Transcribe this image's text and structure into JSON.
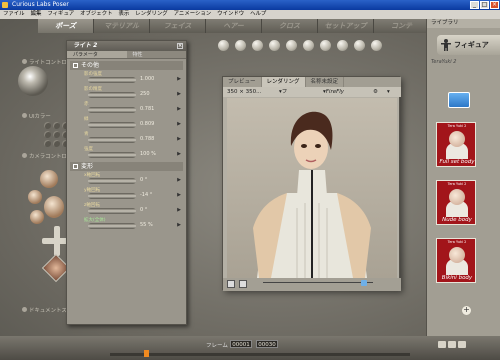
{
  "window": {
    "title": "Curious Labs Poser"
  },
  "menu": [
    "ファイル",
    "編集",
    "フィギュア",
    "オブジェクト",
    "表示",
    "レンダリング",
    "アニメーション",
    "ウインドウ",
    "ヘルプ"
  ],
  "rooms": [
    "ポーズ",
    "マテリアル",
    "フェイス",
    "ヘアー",
    "クロス",
    "セットアップ",
    "コンテ"
  ],
  "left_tools": {
    "light_controls": "ライトコントロ",
    "ui_label": "UIカラー",
    "camera_controls": "カメラコントロール",
    "doc_style": "ドキュメントスタイ"
  },
  "param_panel": {
    "title": "ライト 2",
    "tabs": [
      "パラメータ",
      "特性"
    ],
    "sections": [
      {
        "label": "その他",
        "params": [
          {
            "name": "影の強度",
            "value": "1.000"
          },
          {
            "name": "影の精度",
            "value": "250"
          },
          {
            "name": "赤",
            "value": "0.781"
          },
          {
            "name": "緑",
            "value": "0.809"
          },
          {
            "name": "青",
            "value": "0.788"
          },
          {
            "name": "強度",
            "value": "100 %"
          }
        ]
      },
      {
        "label": "変形",
        "params": [
          {
            "name": "x軸回転",
            "value": "0 °"
          },
          {
            "name": "y軸回転",
            "value": "-14 °"
          },
          {
            "name": "z軸回転",
            "value": "0 °"
          },
          {
            "name": "拡大(全体)",
            "value": "55 %",
            "green": true
          }
        ]
      }
    ]
  },
  "document": {
    "tabs": [
      "プレビュー",
      "レンダリング",
      "名称未設定"
    ],
    "size": "350 × 350...",
    "mode": "フル",
    "renderer": "FireFly"
  },
  "library": {
    "title": "ライブラリ",
    "category": "フィギュア",
    "path": "TeraYuki 2",
    "items": [
      {
        "top": "Tera Yuki 2",
        "caption": "Full set body"
      },
      {
        "top": "Tera Yuki 2",
        "caption": "Nude body"
      },
      {
        "top": "Tera Yuki 2",
        "caption": "Bikini body"
      }
    ]
  },
  "timeline": {
    "frame_label": "フレーム",
    "current": "00001",
    "total": "00030"
  },
  "colors": {
    "accent_title": "#0a3aa0",
    "thumb_red": "#a2151a",
    "timeline_marker": "#f08a20"
  }
}
